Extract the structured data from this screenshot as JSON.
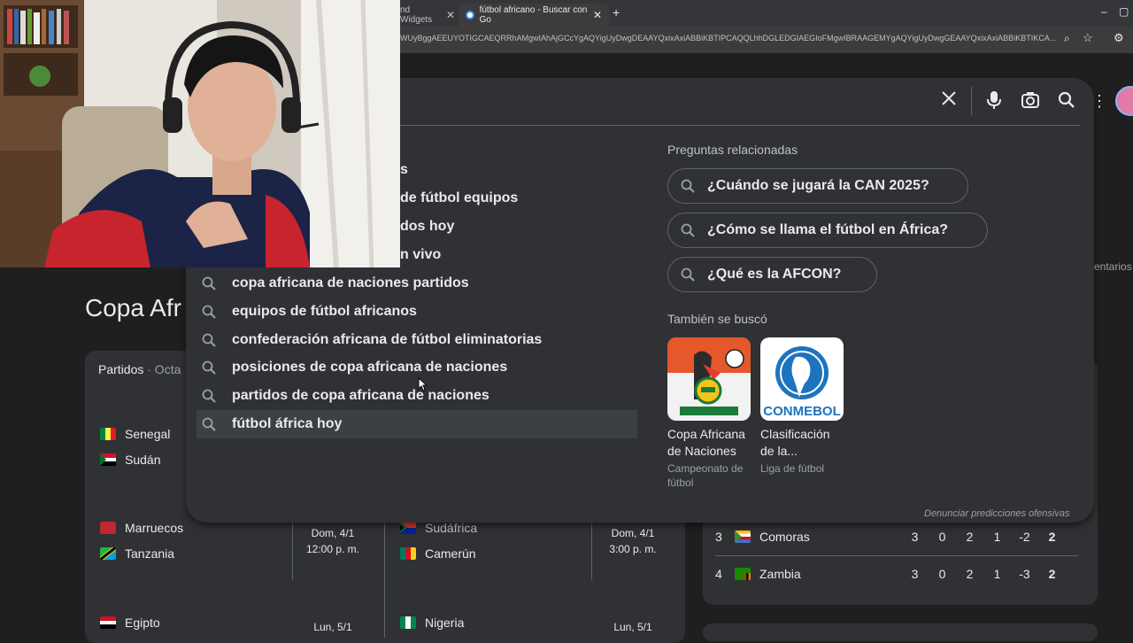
{
  "browser": {
    "tabs": [
      {
        "label": "nd Widgets",
        "active": false
      },
      {
        "label": "fútbol africano - Buscar con Go",
        "active": true
      }
    ],
    "url": "WUyBggAEEUYOTIGCAEQRRhAMgwIAhAjGCcYgAQYigUyDwgDEAAYQxixAxiABBiKBTIPCAQQLhhDGLEDGIAEGIoFMgwIBRAAGEMYgAQYigUyDwgGEAAYQxixAxiABBiKBTIKCA..."
  },
  "search": {
    "partial_suggestions": [
      "s",
      "de fútbol equipos",
      "dos hoy",
      "n vivo"
    ],
    "suggestions": [
      "copa africana de naciones partidos",
      "equipos de fútbol africanos",
      "confederación africana de fútbol eliminatorias",
      "posiciones de copa africana de naciones",
      "partidos de copa africana de naciones",
      "fútbol áfrica hoy"
    ],
    "related_title": "Preguntas relacionadas",
    "related": [
      "¿Cuándo se jugará la CAN 2025?",
      "¿Cómo se llama el fútbol en África?",
      "¿Qué es la AFCON?"
    ],
    "also_title": "También se buscó",
    "cards": [
      {
        "title": "Copa Africana de Naciones",
        "sub": "Campeonato de fútbol"
      },
      {
        "title": "Clasificación de la...",
        "sub": "Liga de fútbol"
      }
    ],
    "card_logo_text": "CONMEBOL",
    "report": "Denunciar predicciones ofensivas"
  },
  "results": {
    "heading": "Copa Afr",
    "tab": "Partidos",
    "tab_sep": " · Octa",
    "matches": [
      {
        "home": "Senegal",
        "away": "Sudán"
      },
      {
        "home": "Marruecos",
        "away": "Tanzania",
        "date": "Dom, 4/1",
        "time": "12:00 p. m."
      },
      {
        "home": "Sudáfrica",
        "away": "Camerún",
        "date": "Dom, 4/1",
        "time": "3:00 p. m."
      },
      {
        "home": "Egipto",
        "date": "Lun, 5/1"
      },
      {
        "home": "Nigeria",
        "date": "Lun, 5/1"
      }
    ],
    "standings": [
      {
        "pos": "3",
        "team": "Comoras",
        "pj": "3",
        "g": "0",
        "e": "2",
        "p": "1",
        "dg": "-2",
        "pts": "2"
      },
      {
        "pos": "4",
        "team": "Zambia",
        "pj": "3",
        "g": "0",
        "e": "2",
        "p": "1",
        "dg": "-3",
        "pts": "2"
      }
    ],
    "side_text": "entarios"
  }
}
